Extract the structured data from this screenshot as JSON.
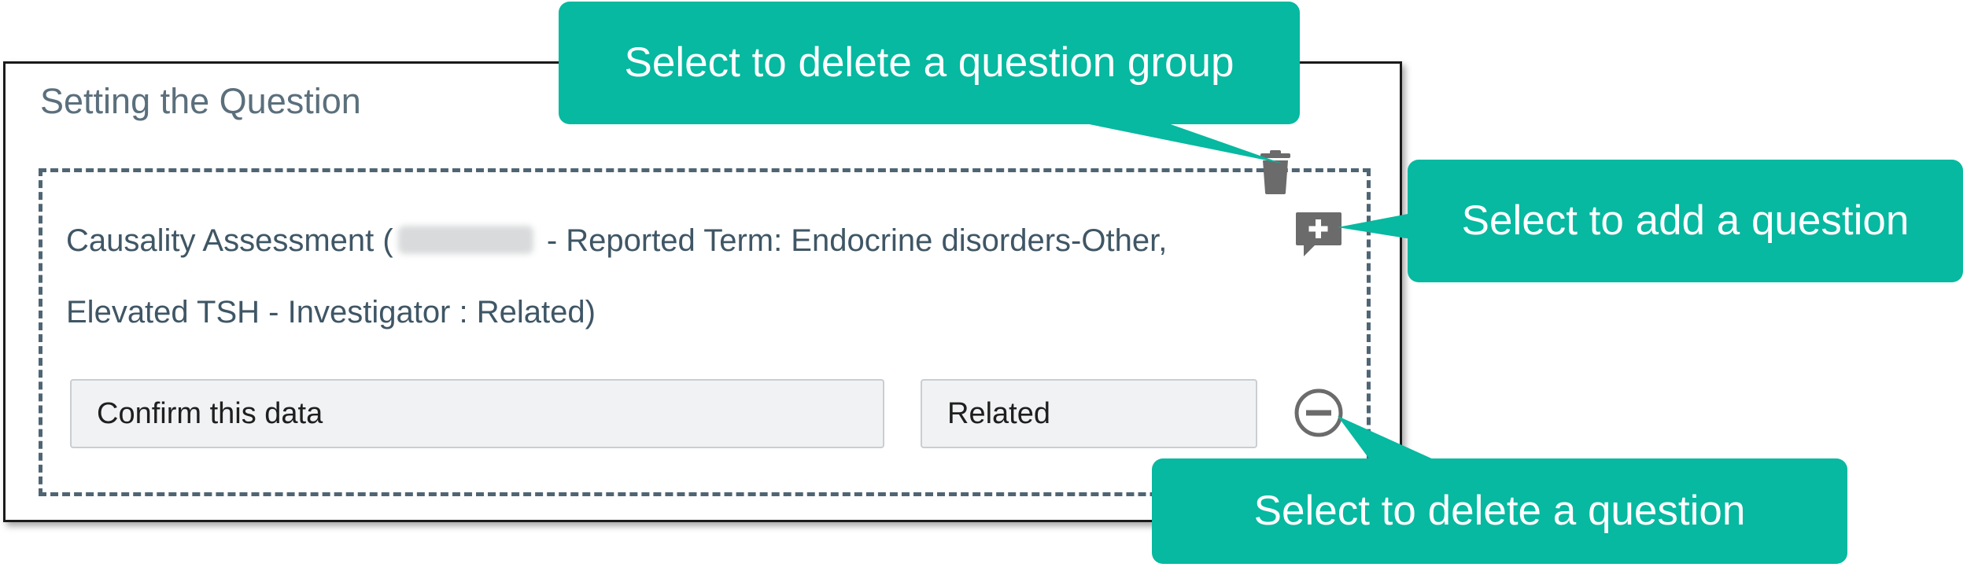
{
  "panel": {
    "title": "Setting the Question"
  },
  "question_group": {
    "assessment_prefix": "Causality Assessment (",
    "assessment_suffix": " - Reported Term: Endocrine disorders-Other,",
    "assessment_line2": "Elevated TSH - Investigator : Related)",
    "question": {
      "prompt_value": "Confirm this data",
      "answer_value": "Related"
    }
  },
  "icons": {
    "delete_group": "trash-icon",
    "add_question": "comment-plus-icon",
    "delete_question": "minus-circle-icon"
  },
  "callouts": {
    "delete_group": "Select to delete a question group",
    "add_question": "Select to add a question",
    "delete_question": "Select to delete a question"
  },
  "colors": {
    "callout": "#06b9a0",
    "dashed_border": "#4f6574",
    "title_text": "#5b6f7c",
    "icon_gray": "#6b6b6b"
  }
}
